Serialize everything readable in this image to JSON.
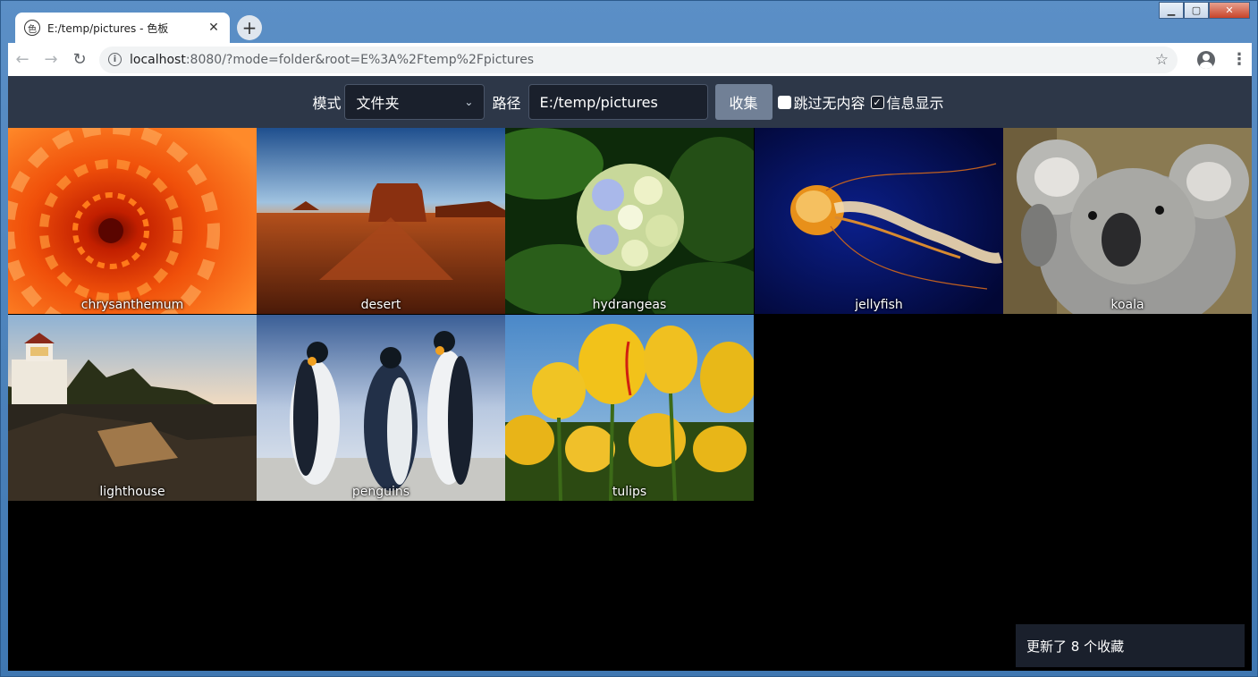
{
  "browser": {
    "tab_title": "E:/temp/pictures - 色板",
    "tab_close": "✕",
    "new_tab": "+",
    "url_host": "localhost",
    "url_rest": ":8080/?mode=folder&root=E%3A%2Ftemp%2Fpictures",
    "info_icon": "i",
    "window_buttons": {
      "minimize": "▁",
      "maximize": "▢",
      "close": "✕"
    }
  },
  "controls": {
    "mode_label": "模式",
    "mode_value": "文件夹",
    "path_label": "路径",
    "path_value": "E:/temp/pictures",
    "collect_button": "收集",
    "skip_empty_label": "跳过无内容",
    "skip_empty_checked": false,
    "show_info_label": "信息显示",
    "show_info_checked": true
  },
  "pictures": [
    {
      "name": "chrysanthemum"
    },
    {
      "name": "desert"
    },
    {
      "name": "hydrangeas"
    },
    {
      "name": "jellyfish"
    },
    {
      "name": "koala"
    },
    {
      "name": "lighthouse"
    },
    {
      "name": "penguins"
    },
    {
      "name": "tulips"
    }
  ],
  "toast": "更新了 8 个收藏",
  "colors": {
    "controls_bg": "#2d3748",
    "input_bg": "#1a202c",
    "button_bg": "#718096",
    "page_bg": "#000000"
  }
}
